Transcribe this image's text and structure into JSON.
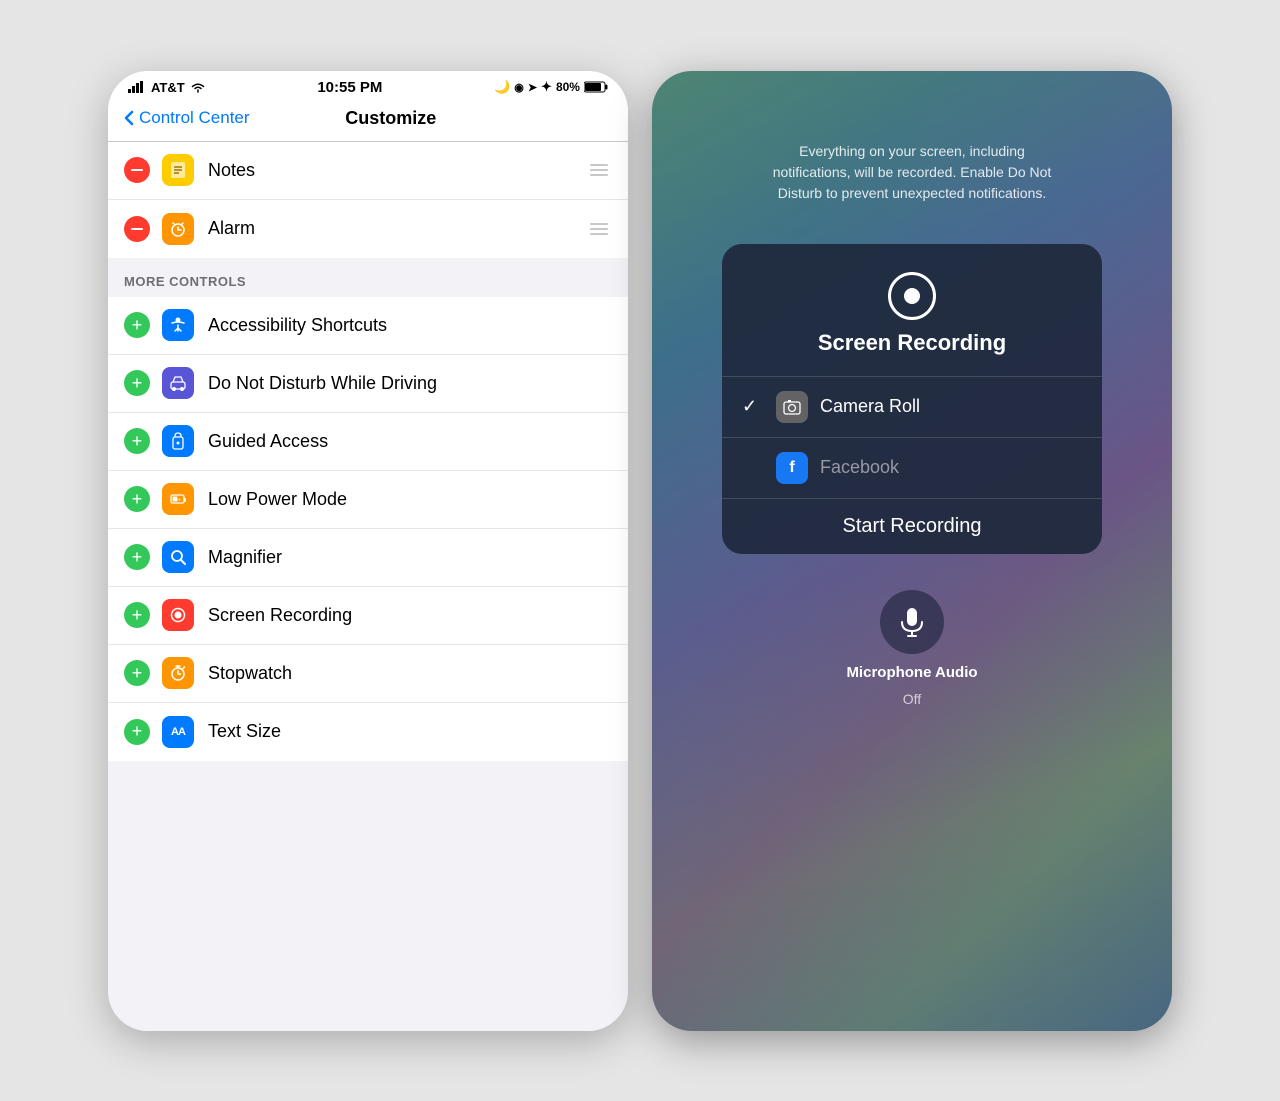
{
  "left": {
    "statusBar": {
      "carrier": "AT&T",
      "time": "10:55 PM",
      "battery": "80%"
    },
    "navBar": {
      "backLabel": "Control Center",
      "title": "Customize"
    },
    "includedSection": {
      "items": [
        {
          "id": "notes",
          "label": "Notes",
          "iconBg": "icon-yellow",
          "iconChar": "📝"
        },
        {
          "id": "alarm",
          "label": "Alarm",
          "iconBg": "icon-orange",
          "iconChar": "⏰"
        }
      ]
    },
    "moreControlsHeader": "MORE CONTROLS",
    "moreControls": {
      "items": [
        {
          "id": "accessibility-shortcuts",
          "label": "Accessibility Shortcuts",
          "iconBg": "icon-blue",
          "iconChar": "♿"
        },
        {
          "id": "do-not-disturb-driving",
          "label": "Do Not Disturb While Driving",
          "iconBg": "icon-purple",
          "iconChar": "🚗"
        },
        {
          "id": "guided-access",
          "label": "Guided Access",
          "iconBg": "icon-blue",
          "iconChar": "🔒"
        },
        {
          "id": "low-power-mode",
          "label": "Low Power Mode",
          "iconBg": "icon-orange",
          "iconChar": "🔋"
        },
        {
          "id": "magnifier",
          "label": "Magnifier",
          "iconBg": "icon-blue",
          "iconChar": "🔍"
        },
        {
          "id": "screen-recording",
          "label": "Screen Recording",
          "iconBg": "icon-red",
          "iconChar": "⏺"
        },
        {
          "id": "stopwatch",
          "label": "Stopwatch",
          "iconBg": "icon-orange",
          "iconChar": "⏱"
        },
        {
          "id": "text-size",
          "label": "Text Size",
          "iconBg": "icon-blue",
          "iconChar": "AA"
        }
      ]
    }
  },
  "right": {
    "infoText": "Everything on your screen, including notifications, will be recorded. Enable Do Not Disturb to prevent unexpected notifications.",
    "popup": {
      "title": "Screen Recording",
      "options": [
        {
          "id": "camera-roll",
          "label": "Camera Roll",
          "checked": true
        },
        {
          "id": "facebook",
          "label": "Facebook",
          "checked": false
        }
      ],
      "startButton": "Start Recording"
    },
    "microphone": {
      "title": "Microphone Audio",
      "status": "Off"
    }
  }
}
